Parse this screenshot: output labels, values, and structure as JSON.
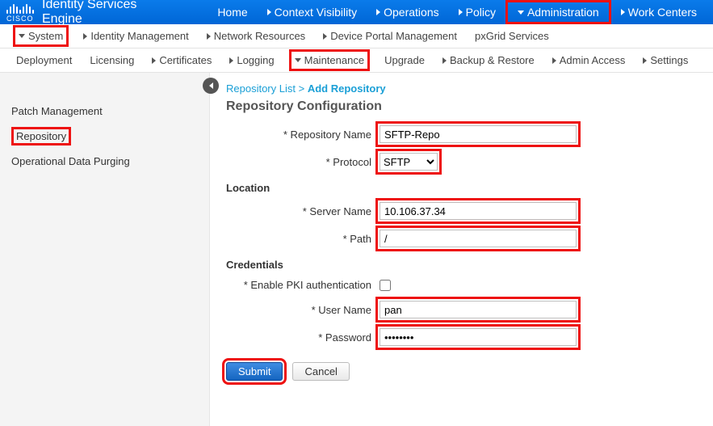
{
  "brand": "Identity Services Engine",
  "logo_text": "CISCO",
  "topnav": {
    "home": "Home",
    "context": "Context Visibility",
    "operations": "Operations",
    "policy": "Policy",
    "administration": "Administration",
    "workcenters": "Work Centers"
  },
  "subnav": {
    "system": "System",
    "identity": "Identity Management",
    "network": "Network Resources",
    "device": "Device Portal Management",
    "pxgrid": "pxGrid Services"
  },
  "subnav2": {
    "deployment": "Deployment",
    "licensing": "Licensing",
    "certificates": "Certificates",
    "logging": "Logging",
    "maintenance": "Maintenance",
    "upgrade": "Upgrade",
    "backup": "Backup & Restore",
    "admin": "Admin Access",
    "settings": "Settings"
  },
  "sidebar": {
    "patch": "Patch Management",
    "repository": "Repository",
    "purging": "Operational Data Purging"
  },
  "breadcrumb": {
    "list": "Repository List",
    "sep": ">",
    "current": "Add Repository"
  },
  "page_title": "Repository Configuration",
  "labels": {
    "repo_name": "* Repository Name",
    "protocol": "* Protocol",
    "location": "Location",
    "server_name": "* Server Name",
    "path": "* Path",
    "credentials": "Credentials",
    "pki": "* Enable PKI authentication",
    "username": "* User Name",
    "password": "* Password"
  },
  "values": {
    "repo_name": "SFTP-Repo",
    "protocol": "SFTP",
    "server_name": "10.106.37.34",
    "path": "/",
    "username": "pan",
    "password": "••••••••"
  },
  "buttons": {
    "submit": "Submit",
    "cancel": "Cancel"
  }
}
